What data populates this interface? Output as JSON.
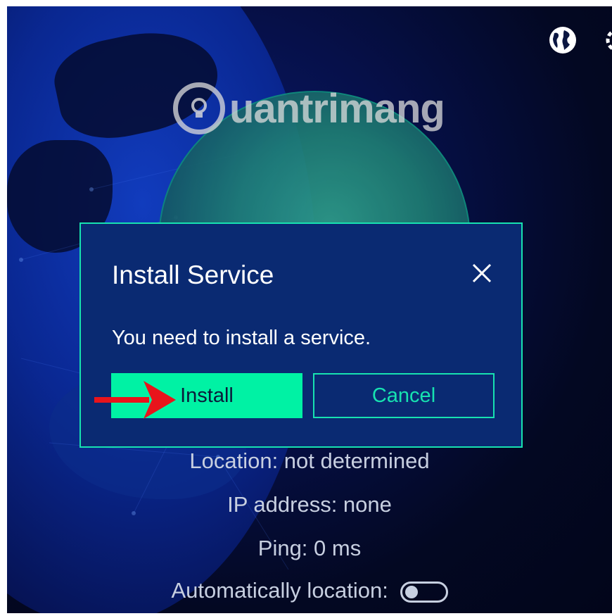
{
  "watermark": {
    "text": "uantrimang"
  },
  "header": {
    "icons": [
      "globe-icon",
      "settings-icon"
    ]
  },
  "dialog": {
    "title": "Install Service",
    "message": "You need to install a service.",
    "install_label": "Install",
    "cancel_label": "Cancel",
    "close_icon": "close-icon"
  },
  "status": {
    "location": "Location: not determined",
    "ip": "IP address: none",
    "ping": "Ping: 0 ms",
    "auto_location_label": "Automatically location:",
    "auto_location_on": false
  },
  "colors": {
    "accent": "#00f2a4",
    "dialog_bg": "#0a2a72",
    "border": "#17e2b0",
    "arrow": "#e8141b"
  }
}
